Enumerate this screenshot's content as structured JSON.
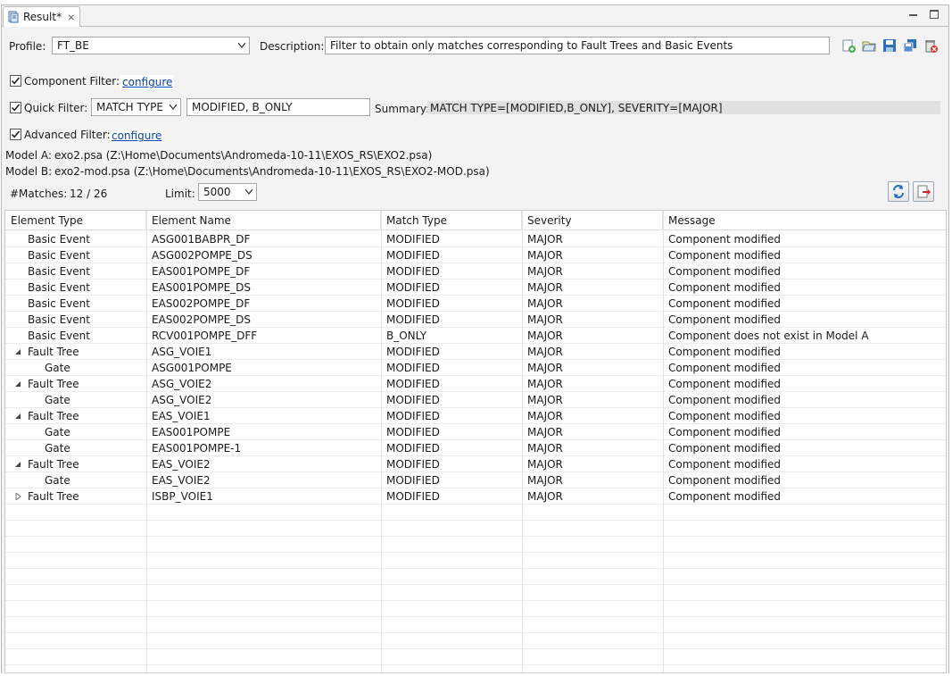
{
  "tab": {
    "label": "Result*",
    "close_glyph": "⨯"
  },
  "filters": {
    "profile_label": "Profile:",
    "profile_value": "FT_BE",
    "description_label": "Description:",
    "description_value": "Filter to obtain only matches corresponding to Fault Trees and Basic Events",
    "component_filter_label": "Component Filter:",
    "component_configure": "configure",
    "quick_filter_label": "Quick Filter:",
    "quick_filter_type": "MATCH TYPE",
    "quick_filter_value": "MODIFIED, B_ONLY",
    "summary_label": "Summary:",
    "summary_value": "MATCH TYPE=[MODIFIED,B_ONLY], SEVERITY=[MAJOR]",
    "advanced_filter_label": "Advanced Filter:",
    "advanced_configure": "configure"
  },
  "models": {
    "model_a_label": "Model A:",
    "model_a_value": "exo2.psa (Z:\\Home\\Documents\\Andromeda-10-11\\EXOS_RS\\EXO2.psa)",
    "model_b_label": "Model B:",
    "model_b_value": "exo2-mod.psa (Z:\\Home\\Documents\\Andromeda-10-11\\EXOS_RS\\EXO2-MOD.psa)"
  },
  "stats": {
    "matches_label": "#Matches:",
    "matches_value": "12 / 26",
    "limit_label": "Limit:",
    "limit_value": "5000"
  },
  "table": {
    "headers": [
      "Element Type",
      "Element Name",
      "Match Type",
      "Severity",
      "Message"
    ],
    "rows": [
      {
        "expander": "",
        "level": 0,
        "type": "Basic Event",
        "name": "ASG001BABPR_DF",
        "match": "MODIFIED",
        "severity": "MAJOR",
        "message": "Component modified"
      },
      {
        "expander": "",
        "level": 0,
        "type": "Basic Event",
        "name": "ASG002POMPE_DS",
        "match": "MODIFIED",
        "severity": "MAJOR",
        "message": "Component modified"
      },
      {
        "expander": "",
        "level": 0,
        "type": "Basic Event",
        "name": "EAS001POMPE_DF",
        "match": "MODIFIED",
        "severity": "MAJOR",
        "message": "Component modified"
      },
      {
        "expander": "",
        "level": 0,
        "type": "Basic Event",
        "name": "EAS001POMPE_DS",
        "match": "MODIFIED",
        "severity": "MAJOR",
        "message": "Component modified"
      },
      {
        "expander": "",
        "level": 0,
        "type": "Basic Event",
        "name": "EAS002POMPE_DF",
        "match": "MODIFIED",
        "severity": "MAJOR",
        "message": "Component modified"
      },
      {
        "expander": "",
        "level": 0,
        "type": "Basic Event",
        "name": "EAS002POMPE_DS",
        "match": "MODIFIED",
        "severity": "MAJOR",
        "message": "Component modified"
      },
      {
        "expander": "",
        "level": 0,
        "type": "Basic Event",
        "name": "RCV001POMPE_DFF",
        "match": "B_ONLY",
        "severity": "MAJOR",
        "message": "Component does not exist in Model A"
      },
      {
        "expander": "expanded",
        "level": 0,
        "type": "Fault Tree",
        "name": "ASG_VOIE1",
        "match": "MODIFIED",
        "severity": "MAJOR",
        "message": "Component modified"
      },
      {
        "expander": "",
        "level": 1,
        "type": "Gate",
        "name": "ASG001POMPE",
        "match": "MODIFIED",
        "severity": "MAJOR",
        "message": "Component modified"
      },
      {
        "expander": "expanded",
        "level": 0,
        "type": "Fault Tree",
        "name": "ASG_VOIE2",
        "match": "MODIFIED",
        "severity": "MAJOR",
        "message": "Component modified"
      },
      {
        "expander": "",
        "level": 1,
        "type": "Gate",
        "name": "ASG_VOIE2",
        "match": "MODIFIED",
        "severity": "MAJOR",
        "message": "Component modified"
      },
      {
        "expander": "expanded",
        "level": 0,
        "type": "Fault Tree",
        "name": "EAS_VOIE1",
        "match": "MODIFIED",
        "severity": "MAJOR",
        "message": "Component modified"
      },
      {
        "expander": "",
        "level": 1,
        "type": "Gate",
        "name": "EAS001POMPE",
        "match": "MODIFIED",
        "severity": "MAJOR",
        "message": "Component modified"
      },
      {
        "expander": "",
        "level": 1,
        "type": "Gate",
        "name": "EAS001POMPE-1",
        "match": "MODIFIED",
        "severity": "MAJOR",
        "message": "Component modified"
      },
      {
        "expander": "expanded",
        "level": 0,
        "type": "Fault Tree",
        "name": "EAS_VOIE2",
        "match": "MODIFIED",
        "severity": "MAJOR",
        "message": "Component modified"
      },
      {
        "expander": "",
        "level": 1,
        "type": "Gate",
        "name": "EAS_VOIE2",
        "match": "MODIFIED",
        "severity": "MAJOR",
        "message": "Component modified"
      },
      {
        "expander": "collapsed",
        "level": 0,
        "type": "Fault Tree",
        "name": "ISBP_VOIE1",
        "match": "MODIFIED",
        "severity": "MAJOR",
        "message": "Component modified"
      }
    ]
  }
}
